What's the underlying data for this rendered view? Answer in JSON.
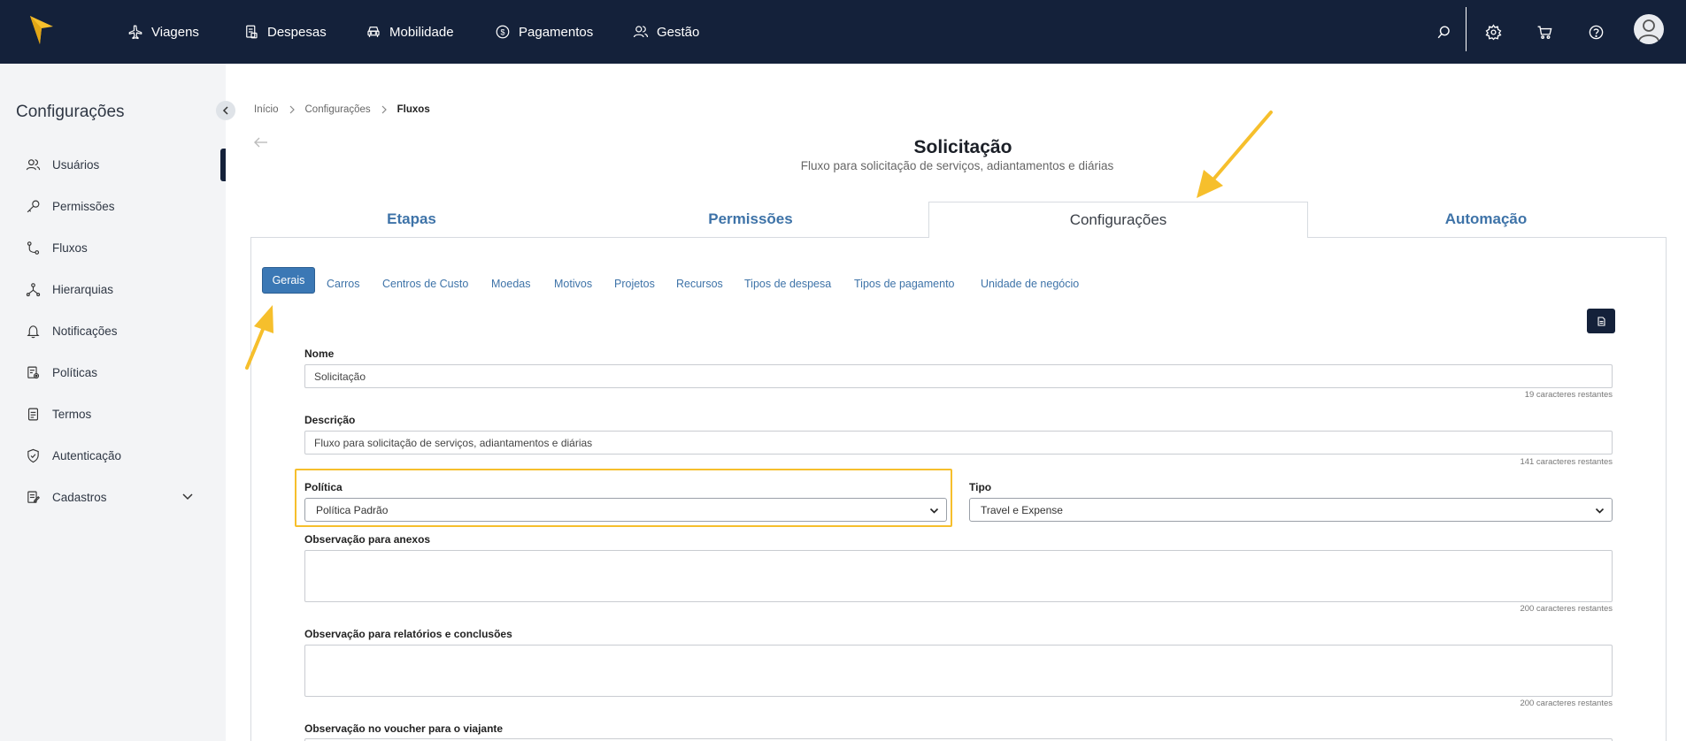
{
  "topnav": {
    "items": [
      {
        "label": "Viagens",
        "icon": "airplane-icon"
      },
      {
        "label": "Despesas",
        "icon": "receipt-icon"
      },
      {
        "label": "Mobilidade",
        "icon": "car-icon"
      },
      {
        "label": "Pagamentos",
        "icon": "dollar-icon"
      },
      {
        "label": "Gestão",
        "icon": "users-icon"
      }
    ],
    "actions": [
      "search-icon",
      "gear-icon",
      "cart-icon",
      "help-icon",
      "avatar-icon"
    ]
  },
  "sidebar": {
    "title": "Configurações",
    "items": [
      {
        "label": "Usuários",
        "icon": "users-icon"
      },
      {
        "label": "Permissões",
        "icon": "key-icon"
      },
      {
        "label": "Fluxos",
        "icon": "flow-icon"
      },
      {
        "label": "Hierarquias",
        "icon": "hierarchy-icon"
      },
      {
        "label": "Notificações",
        "icon": "bell-icon"
      },
      {
        "label": "Políticas",
        "icon": "policy-icon"
      },
      {
        "label": "Termos",
        "icon": "document-icon"
      },
      {
        "label": "Autenticação",
        "icon": "shield-icon"
      },
      {
        "label": "Cadastros",
        "icon": "register-icon"
      }
    ],
    "active_item": "Fluxos"
  },
  "breadcrumb": {
    "items": [
      "Início",
      "Configurações",
      "Fluxos"
    ]
  },
  "page": {
    "title": "Solicitação",
    "subtitle": "Fluxo para solicitação de serviços, adiantamentos e diárias"
  },
  "main_tabs": {
    "items": [
      "Etapas",
      "Permissões",
      "Configurações",
      "Automação"
    ],
    "active": "Configurações"
  },
  "sub_tabs": {
    "items": [
      "Gerais",
      "Carros",
      "Centros de Custo",
      "Moedas",
      "Motivos",
      "Projetos",
      "Recursos",
      "Tipos de despesa",
      "Tipos de pagamento",
      "Unidade de negócio"
    ],
    "active": "Gerais"
  },
  "form": {
    "nome": {
      "label": "Nome",
      "value": "Solicitação",
      "hint": "19 caracteres restantes"
    },
    "descricao": {
      "label": "Descrição",
      "value": "Fluxo para solicitação de serviços, adiantamentos e diárias",
      "hint": "141 caracteres restantes"
    },
    "politica": {
      "label": "Política",
      "value": "Política Padrão"
    },
    "tipo": {
      "label": "Tipo",
      "value": "Travel e Expense"
    },
    "obs_anexos": {
      "label": "Observação para anexos",
      "value": "",
      "hint": "200 caracteres restantes"
    },
    "obs_relatorios": {
      "label": "Observação para relatórios e conclusões",
      "value": "",
      "hint": "200 caracteres restantes"
    },
    "obs_voucher": {
      "label": "Observação no voucher para o viajante"
    }
  },
  "colors": {
    "topbar": "#14213a",
    "accent_blue": "#3e73a8",
    "active_subtab": "#3b78b5",
    "annotation_yellow": "#f6bf2c"
  }
}
